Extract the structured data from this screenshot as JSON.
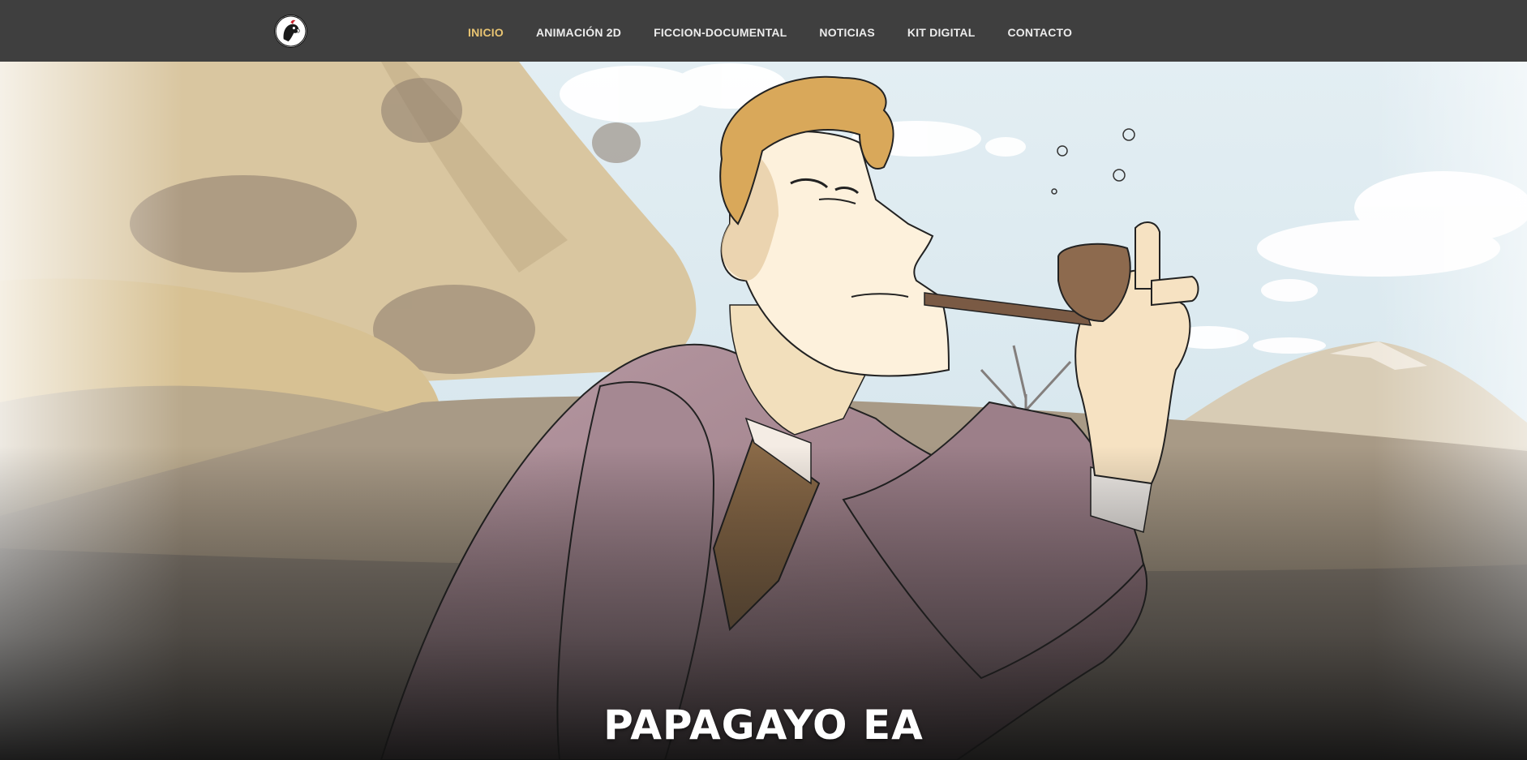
{
  "nav": {
    "logo_icon": "parrot-logo-icon",
    "items": [
      {
        "label": "INICIO",
        "active": true
      },
      {
        "label": "ANIMACIÓN 2D",
        "active": false
      },
      {
        "label": "FICCION-DOCUMENTAL",
        "active": false
      },
      {
        "label": "NOTICIAS",
        "active": false
      },
      {
        "label": "KIT DIGITAL",
        "active": false
      },
      {
        "label": "CONTACTO",
        "active": false
      }
    ],
    "active_color": "#e8c472",
    "bar_color": "#3f3f3f"
  },
  "hero": {
    "title": "PAPAGAYO EA",
    "image": "cartoon-man-smoking-pipe-landscape"
  }
}
